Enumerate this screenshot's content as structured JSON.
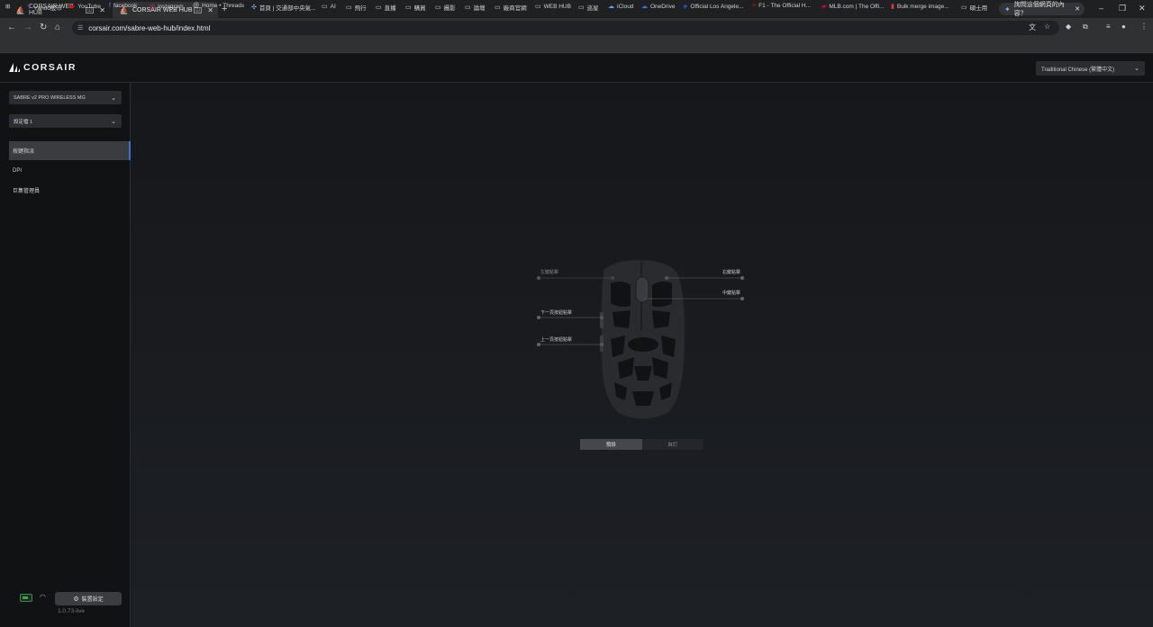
{
  "browser": {
    "tabs": [
      {
        "title": "CORSAIR WEB HUB"
      },
      {
        "title": "CORSAIR WEB HUB"
      }
    ],
    "promo_text": "詢問這個網頁的內容？",
    "url": "corsair.com/sabre-web-hub/index.html",
    "bookmarks": [
      {
        "label": "Yahoo股市",
        "icon": "yahoo-icon"
      },
      {
        "label": "YouTube",
        "icon": "youtube-icon"
      },
      {
        "label": "facebook",
        "icon": "facebook-icon"
      },
      {
        "label": "instagram",
        "icon": "instagram-icon"
      },
      {
        "label": "Home • Threads",
        "icon": "threads-icon"
      },
      {
        "label": "首頁 | 交通部中央氣...",
        "icon": "weather-icon"
      },
      {
        "label": "AI",
        "icon": "folder-icon"
      },
      {
        "label": "飛行",
        "icon": "folder-icon"
      },
      {
        "label": "直播",
        "icon": "folder-icon"
      },
      {
        "label": "購買",
        "icon": "folder-icon"
      },
      {
        "label": "攝影",
        "icon": "folder-icon"
      },
      {
        "label": "論壇",
        "icon": "folder-icon"
      },
      {
        "label": "廠商官網",
        "icon": "folder-icon"
      },
      {
        "label": "WEB HUB",
        "icon": "folder-icon"
      },
      {
        "label": "巡星",
        "icon": "folder-icon"
      },
      {
        "label": "iCloud",
        "icon": "icloud-icon"
      },
      {
        "label": "OneDrive",
        "icon": "onedrive-icon"
      },
      {
        "label": "Official Los Angele...",
        "icon": "dodgers-icon"
      },
      {
        "label": "F1 - The Official H...",
        "icon": "f1-icon"
      },
      {
        "label": "MLB.com | The Offi...",
        "icon": "mlb-icon"
      },
      {
        "label": "Bulk merge image...",
        "icon": "pdf-icon"
      },
      {
        "label": "碩士用",
        "icon": "folder-icon"
      }
    ]
  },
  "app": {
    "logo_text": "CORSAIR",
    "language": "Traditional Chinese (繁體中文)",
    "device_select": "SABRE v2 PRO WIRELESS MG",
    "profile_select": "設定檔 1",
    "nav": [
      {
        "label": "按鍵指派",
        "active": true
      },
      {
        "label": "DPI",
        "active": false
      },
      {
        "label": "巨集管理員",
        "active": false
      }
    ],
    "device_settings": "裝置設定",
    "version": "1.0.73-live",
    "button_labels": {
      "left_click": "左鍵點擊",
      "right_click": "右鍵點擊",
      "middle_click": "中鍵點擊",
      "forward": "下一頁按鈕點擊",
      "back": "上一頁按鈕點擊"
    },
    "mode_toggle": {
      "preset": "預設",
      "custom": "自訂",
      "selected": "預設"
    },
    "colors": {
      "accent": "#3a6fd8",
      "battery": "#3ba64c"
    }
  }
}
